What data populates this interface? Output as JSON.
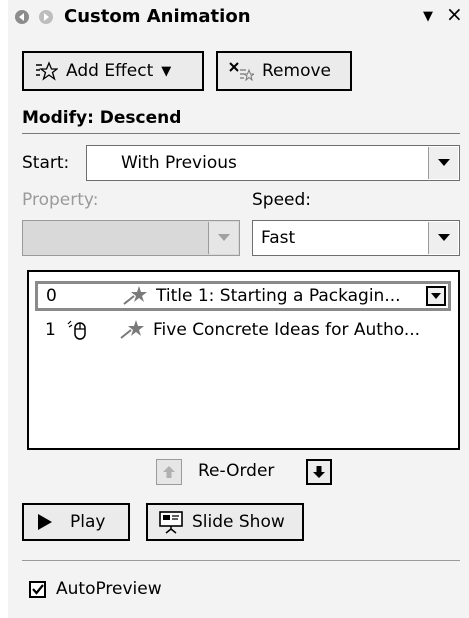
{
  "window": {
    "title": "Custom Animation",
    "menu_glyph": "▼",
    "close_glyph": "×"
  },
  "toolbar": {
    "add_effect_label": "Add Effect",
    "add_effect_arrow": "▼",
    "remove_label": "Remove"
  },
  "modify": {
    "heading": "Modify: Descend",
    "start_label": "Start:",
    "start_value": "With Previous",
    "property_label": "Property:",
    "property_value": "",
    "speed_label": "Speed:",
    "speed_value": "Fast"
  },
  "animation_list": [
    {
      "number": "0",
      "has_mouse": false,
      "text": "Title 1: Starting a Packagin...",
      "selected": true
    },
    {
      "number": "1",
      "has_mouse": true,
      "text": "Five Concrete Ideas for Autho...",
      "selected": false
    }
  ],
  "reorder": {
    "label": "Re-Order"
  },
  "actions": {
    "play_label": "Play",
    "slideshow_label": "Slide Show"
  },
  "autopreview": {
    "label": "AutoPreview",
    "checked": true
  },
  "icons": {
    "back": "back-arrow-icon",
    "forward": "forward-arrow-icon",
    "add_effect": "star-effect-icon",
    "remove": "remove-icon",
    "effect": "effect-star-icon",
    "mouse": "mouse-click-icon",
    "up": "move-up-icon",
    "down": "move-down-icon",
    "play": "play-icon",
    "slideshow": "slideshow-icon"
  }
}
